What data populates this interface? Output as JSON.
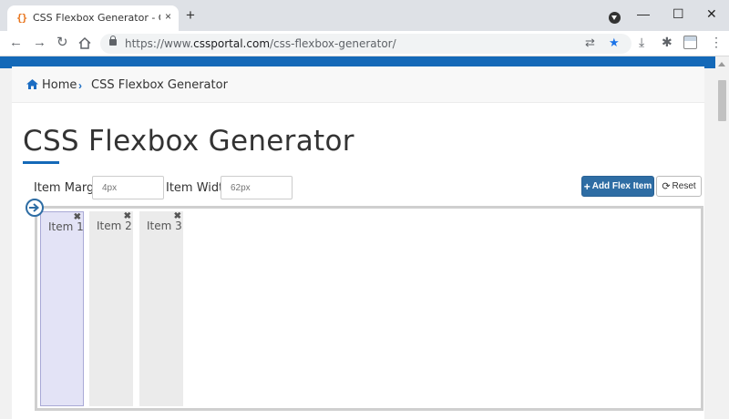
{
  "browser": {
    "tab_title": "CSS Flexbox Generator - CSS Portal",
    "favicon_glyph": "{}",
    "close_glyph": "×",
    "newtab_glyph": "+",
    "url_prefix": "https://www.",
    "url_main": "cssportal.com",
    "url_path": "/css-flexbox-generator/",
    "back_glyph": "←",
    "forward_glyph": "→",
    "reload_glyph": "↻",
    "minimize_glyph": "—",
    "maximize_glyph": "☐",
    "window_close_glyph": "✕",
    "translate_glyph": "⇄",
    "star_glyph": "★",
    "download_glyph": "⤓",
    "extensions_glyph": "✱",
    "menu_glyph": "⋮"
  },
  "breadcrumb": {
    "home": "Home",
    "separator": "›",
    "current": "CSS Flexbox Generator"
  },
  "page": {
    "title": "CSS Flexbox Generator"
  },
  "controls": {
    "item_margin_label": "Item Margin",
    "item_margin_placeholder": "4px",
    "item_width_label": "Item Width",
    "item_width_placeholder": "62px",
    "add_button": "Add Flex Item",
    "add_glyph": "+",
    "reset_button": "Reset",
    "reset_glyph": "⟳"
  },
  "flex_items": [
    {
      "label": "Item 1",
      "close": "✖"
    },
    {
      "label": "Item 2",
      "close": "✖"
    },
    {
      "label": "Item 3",
      "close": "✖"
    }
  ],
  "colors": {
    "brand_blue": "#1469b8",
    "button_blue": "#2e6da4",
    "active_item_bg": "#e3e3f6",
    "item_bg": "#ebebeb"
  },
  "icons": {
    "home": "home-icon",
    "direction": "arrow-right-circle-icon",
    "lock": "lock-icon",
    "bookmark": "star-icon"
  }
}
